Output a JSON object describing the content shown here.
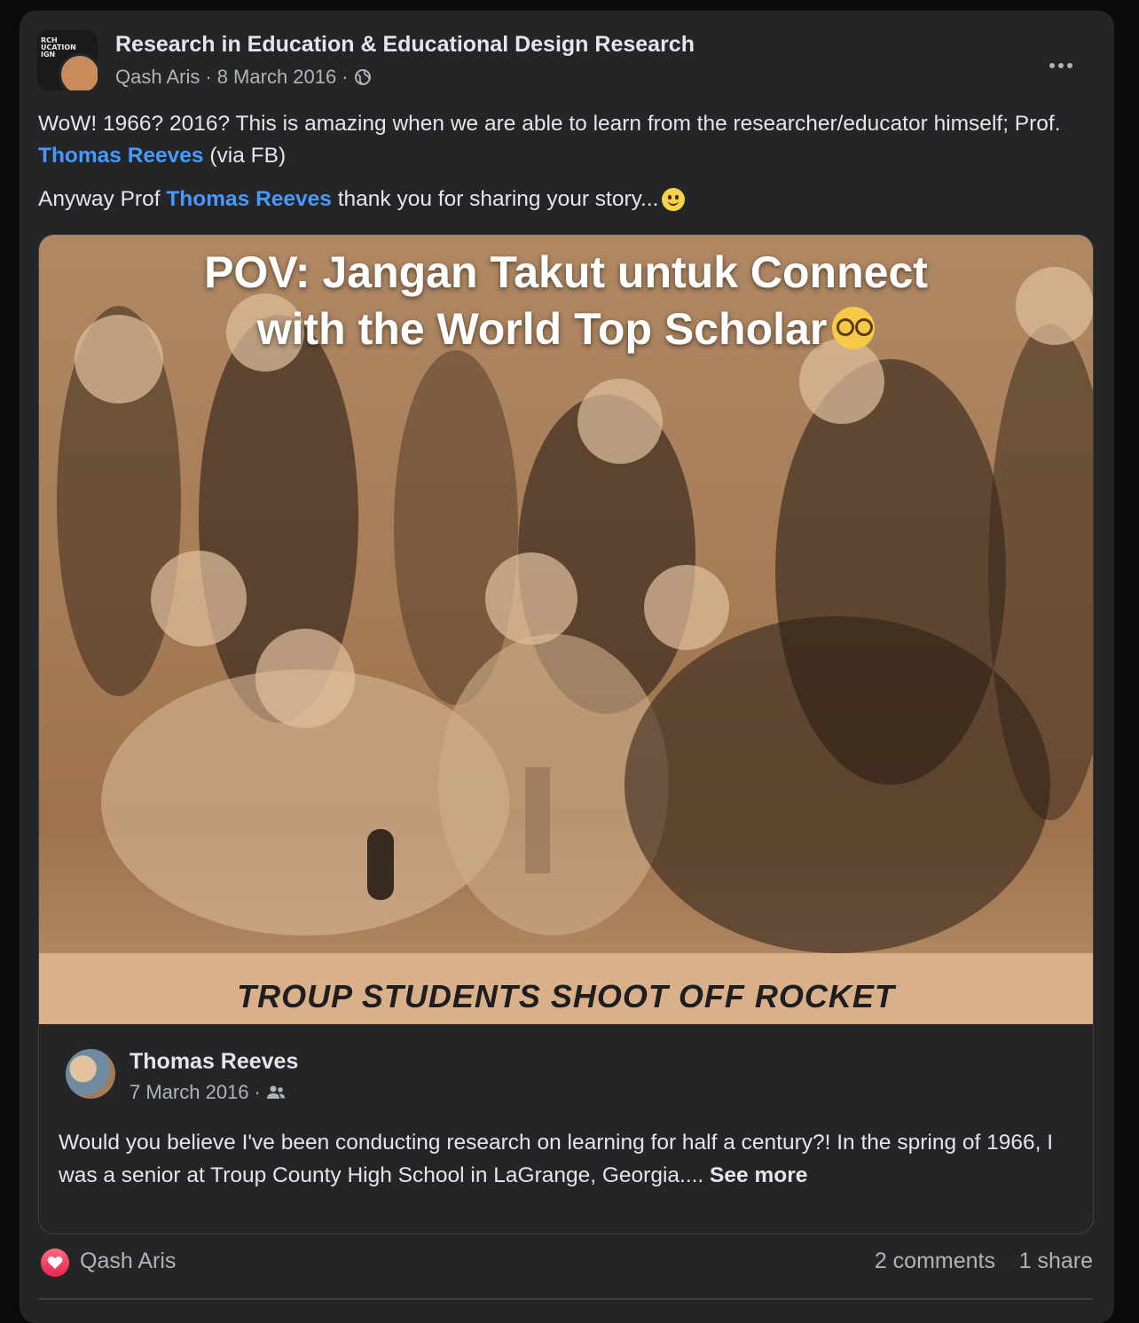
{
  "post": {
    "group_name": "Research in Education & Educational Design Research",
    "author": "Qash Aris",
    "separator": "·",
    "date": "8 March 2016",
    "avatar_text": "RCH\nUCATION\nIGN",
    "paragraph1_before": "WoW! 1966? 2016? This is amazing when we are able to learn from the researcher/educator himself; Prof. ",
    "paragraph1_mention": "Thomas Reeves",
    "paragraph1_after": " (via FB)",
    "paragraph2_before": "Anyway Prof ",
    "paragraph2_mention": "Thomas Reeves",
    "paragraph2_after": " thank you for sharing your story..."
  },
  "photo": {
    "overlay_line1": "POV: Jangan Takut untuk Connect",
    "overlay_line2": "with the World Top Scholar",
    "caption": "TROUP STUDENTS SHOOT OFF ROCKET"
  },
  "shared": {
    "name": "Thomas Reeves",
    "date": "7 March 2016",
    "separator": "·",
    "text": "Would you believe I've been conducting research on learning for half a century?! In the spring of 1966, I was a senior at Troup County High School in LaGrange, Georgia.... ",
    "see_more": "See more"
  },
  "reactions": {
    "reactor": "Qash Aris",
    "comments": "2 comments",
    "shares": "1 share"
  },
  "colors": {
    "background": "#242526",
    "text": "#e4e6eb",
    "secondary": "#b0b3b8",
    "link": "#4599ff",
    "love": "#e4254a"
  }
}
